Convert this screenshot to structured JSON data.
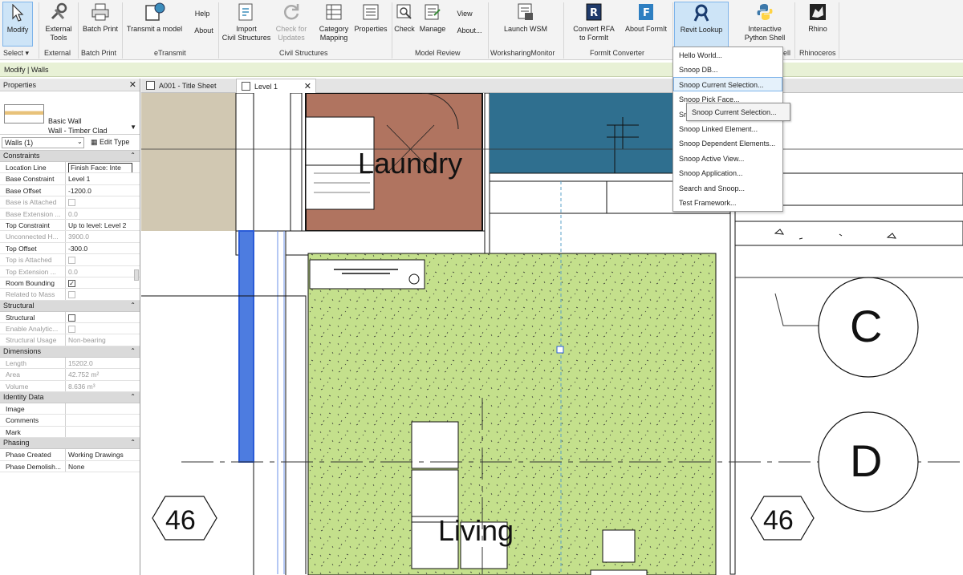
{
  "ribbon": {
    "buttons": [
      {
        "id": "modify",
        "label": "Modify",
        "icon": "cursor-arrow-icon"
      },
      {
        "id": "external_tools",
        "label": "External\nTools",
        "icon": "tools-icon"
      },
      {
        "id": "batch_print",
        "label": "Batch Print",
        "icon": "printer-icon"
      },
      {
        "id": "transmit",
        "label": "Transmit a model",
        "icon": "transmit-icon"
      },
      {
        "id": "help",
        "label": "Help",
        "icon": ""
      },
      {
        "id": "about",
        "label": "About",
        "icon": ""
      },
      {
        "id": "import_civil",
        "label": "Import\nCivil Structures",
        "icon": "import-icon"
      },
      {
        "id": "check_updates",
        "label": "Check for\nUpdates",
        "icon": "refresh-icon"
      },
      {
        "id": "category_mapping",
        "label": "Category\nMapping",
        "icon": "mapping-icon"
      },
      {
        "id": "properties",
        "label": "Properties",
        "icon": "properties-icon"
      },
      {
        "id": "check",
        "label": "Check",
        "icon": "check-icon"
      },
      {
        "id": "manage",
        "label": "Manage",
        "icon": "manage-icon"
      },
      {
        "id": "view",
        "label": "View",
        "icon": ""
      },
      {
        "id": "about2",
        "label": "About...",
        "icon": ""
      },
      {
        "id": "launch_wsm",
        "label": "Launch WSM",
        "icon": "wsm-icon"
      },
      {
        "id": "convert_rfa",
        "label": "Convert RFA\nto FormIt",
        "icon": "convert-icon"
      },
      {
        "id": "about_formit",
        "label": "About FormIt",
        "icon": "formit-icon"
      },
      {
        "id": "revit_lookup",
        "label": "Revit Lookup",
        "icon": "lookup-icon"
      },
      {
        "id": "python_shell",
        "label": "Interactive\nPython Shell",
        "icon": "python-icon"
      },
      {
        "id": "rhino",
        "label": "Rhino",
        "icon": "rhino-icon"
      }
    ],
    "panels": [
      {
        "id": "select",
        "label": "Select ▾"
      },
      {
        "id": "external",
        "label": "External"
      },
      {
        "id": "batch",
        "label": "Batch Print"
      },
      {
        "id": "etransmit",
        "label": "eTransmit"
      },
      {
        "id": "civil",
        "label": "Civil Structures"
      },
      {
        "id": "review",
        "label": "Model Review"
      },
      {
        "id": "wsm",
        "label": "WorksharingMonitor"
      },
      {
        "id": "formit",
        "label": "FormIt Converter"
      },
      {
        "id": "shell",
        "label": "ell"
      },
      {
        "id": "rhinoceros",
        "label": "Rhinoceros"
      }
    ]
  },
  "context_bar": "Modify | Walls",
  "properties": {
    "title": "Properties",
    "type_family": "Basic Wall",
    "type_name": "Wall - Timber Clad",
    "instance_filter": "Walls (1)",
    "edit_type": "Edit Type",
    "groups": [
      {
        "name": "Constraints",
        "rows": [
          {
            "k": "Location Line",
            "v": "Finish Face: Inte",
            "input": true
          },
          {
            "k": "Base Constraint",
            "v": "Level 1"
          },
          {
            "k": "Base Offset",
            "v": "-1200.0"
          },
          {
            "k": "Base is Attached",
            "v": "",
            "check": true,
            "dim": true
          },
          {
            "k": "Base Extension ...",
            "v": "0.0",
            "dim": true
          },
          {
            "k": "Top Constraint",
            "v": "Up to level: Level 2"
          },
          {
            "k": "Unconnected H...",
            "v": "3900.0",
            "dim": true
          },
          {
            "k": "Top Offset",
            "v": "-300.0"
          },
          {
            "k": "Top is Attached",
            "v": "",
            "check": true,
            "dim": true
          },
          {
            "k": "Top Extension ...",
            "v": "0.0",
            "dim": true
          },
          {
            "k": "Room Bounding",
            "v": "✓",
            "check": true
          },
          {
            "k": "Related to Mass",
            "v": "",
            "check": true,
            "dim": true
          }
        ]
      },
      {
        "name": "Structural",
        "rows": [
          {
            "k": "Structural",
            "v": "",
            "check": true
          },
          {
            "k": "Enable Analytic...",
            "v": "",
            "check": true,
            "dim": true
          },
          {
            "k": "Structural Usage",
            "v": "Non-bearing",
            "dim": true
          }
        ]
      },
      {
        "name": "Dimensions",
        "rows": [
          {
            "k": "Length",
            "v": "15202.0",
            "dim": true
          },
          {
            "k": "Area",
            "v": "42.752 m²",
            "dim": true
          },
          {
            "k": "Volume",
            "v": "8.636 m³",
            "dim": true
          }
        ]
      },
      {
        "name": "Identity Data",
        "rows": [
          {
            "k": "Image",
            "v": ""
          },
          {
            "k": "Comments",
            "v": ""
          },
          {
            "k": "Mark",
            "v": ""
          }
        ]
      },
      {
        "name": "Phasing",
        "rows": [
          {
            "k": "Phase Created",
            "v": "Working Drawings"
          },
          {
            "k": "Phase Demolish...",
            "v": "None"
          }
        ]
      }
    ]
  },
  "tabs": [
    {
      "label": "A001 - Title Sheet",
      "active": false
    },
    {
      "label": "Level 1",
      "active": true
    }
  ],
  "drawing": {
    "room_laundry": "Laundry",
    "room_living": "Living",
    "grid_c": "C",
    "grid_d": "D",
    "level_left": "46",
    "level_right": "46",
    "colors": {
      "laundry": "#b07460",
      "living": "#c4e08c",
      "blue": "#2f6f8f",
      "tan": "#d1c8b2",
      "selected": "#2a5bd7"
    }
  },
  "menu": {
    "items": [
      "Hello World...",
      "Snoop DB...",
      "Snoop Current Selection...",
      "Snoop Pick Face...",
      "Sn",
      "Snoop Linked Element...",
      "Snoop Dependent Elements...",
      "Snoop Active View...",
      "Snoop Application...",
      "Search and Snoop...",
      "Test Framework..."
    ],
    "highlighted": 2,
    "tooltip": "Snoop Current Selection..."
  }
}
